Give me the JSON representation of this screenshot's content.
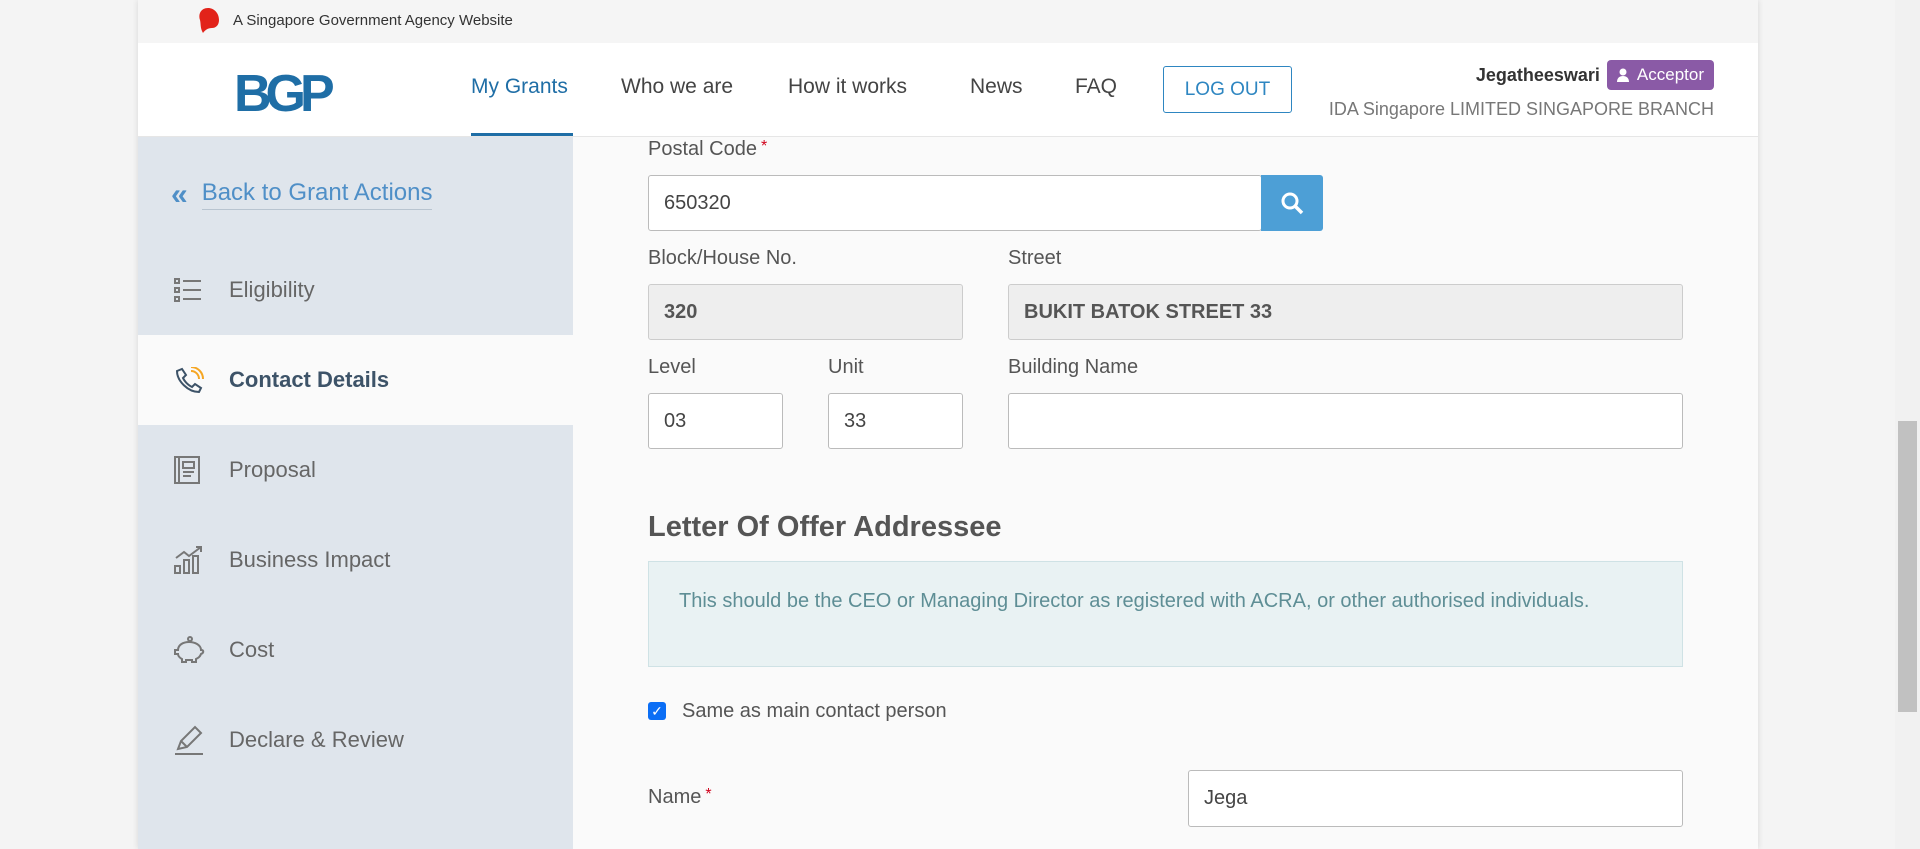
{
  "gov_banner": {
    "text": "A Singapore Government Agency Website"
  },
  "header": {
    "logo": "BGP",
    "nav": [
      "My Grants",
      "Who we are",
      "How it works",
      "News",
      "FAQ"
    ],
    "logout": "LOG OUT",
    "user": {
      "name": "Jegatheeswari",
      "role": "Acceptor",
      "org": "IDA Singapore LIMITED SINGAPORE BRANCH"
    }
  },
  "sidebar": {
    "back": "Back to Grant Actions",
    "items": [
      {
        "label": "Eligibility"
      },
      {
        "label": "Contact Details"
      },
      {
        "label": "Proposal"
      },
      {
        "label": "Business Impact"
      },
      {
        "label": "Cost"
      },
      {
        "label": "Declare & Review"
      }
    ]
  },
  "form": {
    "postal_code": {
      "label": "Postal Code",
      "value": "650320"
    },
    "block": {
      "label": "Block/House No.",
      "value": "320"
    },
    "street": {
      "label": "Street",
      "value": "BUKIT BATOK STREET 33"
    },
    "level": {
      "label": "Level",
      "value": "03"
    },
    "unit": {
      "label": "Unit",
      "value": "33"
    },
    "building": {
      "label": "Building Name",
      "value": ""
    },
    "section_title": "Letter Of Offer Addressee",
    "info": "This should be the CEO or Managing Director as registered with ACRA, or other authorised individuals.",
    "same_as_main": {
      "label": "Same as main contact person",
      "checked": true
    },
    "name": {
      "label": "Name",
      "value": "Jega"
    },
    "required_mark": "*"
  },
  "colors": {
    "brand": "#1f6ea6",
    "accent": "#4d9fd6",
    "badge": "#8a5aa6",
    "sidebar": "#dfe5ec"
  }
}
